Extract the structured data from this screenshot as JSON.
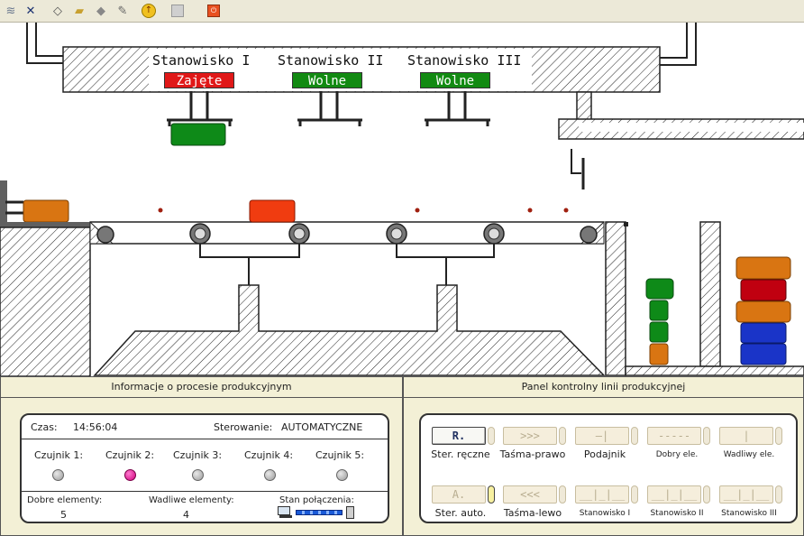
{
  "toolbar": {
    "buttons": [
      {
        "icon": "wire-icon"
      },
      {
        "icon": "disconnect-icon"
      },
      {
        "icon": "new-icon"
      },
      {
        "icon": "open-folder-icon"
      },
      {
        "icon": "stop-icon"
      },
      {
        "icon": "edit-icon"
      },
      {
        "icon": "run-icon"
      },
      {
        "icon": "grid-icon"
      },
      {
        "icon": "power-icon"
      }
    ]
  },
  "stations": [
    {
      "name": "Stanowisko I",
      "status": "Zajęte",
      "color": "#e01818"
    },
    {
      "name": "Stanowisko II",
      "status": "Wolne",
      "color": "#128a12"
    },
    {
      "name": "Stanowisko III",
      "status": "Wolne",
      "color": "#128a12"
    }
  ],
  "colors": {
    "green": "#0e8a18",
    "orange": "#d97512",
    "red_orange": "#f03c10",
    "red": "#c00010",
    "blue": "#1a34c8"
  },
  "info_panel": {
    "title": "Informacje o procesie produkcyjnym",
    "time_label": "Czas:",
    "time_value": "14:56:04",
    "control_label": "Sterowanie:",
    "control_value": "AUTOMATYCZNE",
    "sensors": [
      {
        "label": "Czujnik 1:",
        "active": false
      },
      {
        "label": "Czujnik 2:",
        "active": true
      },
      {
        "label": "Czujnik 3:",
        "active": false
      },
      {
        "label": "Czujnik 4:",
        "active": false
      },
      {
        "label": "Czujnik 5:",
        "active": false
      }
    ],
    "good_label": "Dobre elementy:",
    "good_value": "5",
    "bad_label": "Wadliwe elementy:",
    "bad_value": "4",
    "connection_label": "Stan połączenia:"
  },
  "control_panel": {
    "title": "Panel kontrolny linii produkcyjnej",
    "row1": [
      {
        "symbol": "R.",
        "label": "Ster. ręczne",
        "active": true
      },
      {
        "symbol": ">>>",
        "label": "Taśma-prawo",
        "active": false
      },
      {
        "symbol": "—|",
        "label": "Podajnik",
        "active": false
      },
      {
        "symbol": "-----",
        "label": "Dobry ele.",
        "active": false
      },
      {
        "symbol": "|",
        "label": "Wadliwy ele.",
        "active": false
      }
    ],
    "row2": [
      {
        "symbol": "A.",
        "label": "Ster. auto.",
        "active": false
      },
      {
        "symbol": "<<<",
        "label": "Taśma-lewo",
        "active": false
      },
      {
        "symbol": "__|_|__",
        "label": "Stanowisko I",
        "active": false
      },
      {
        "symbol": "__|_|__",
        "label": "Stanowisko II",
        "active": false
      },
      {
        "symbol": "__|_|__",
        "label": "Stanowisko III",
        "active": false
      }
    ]
  }
}
